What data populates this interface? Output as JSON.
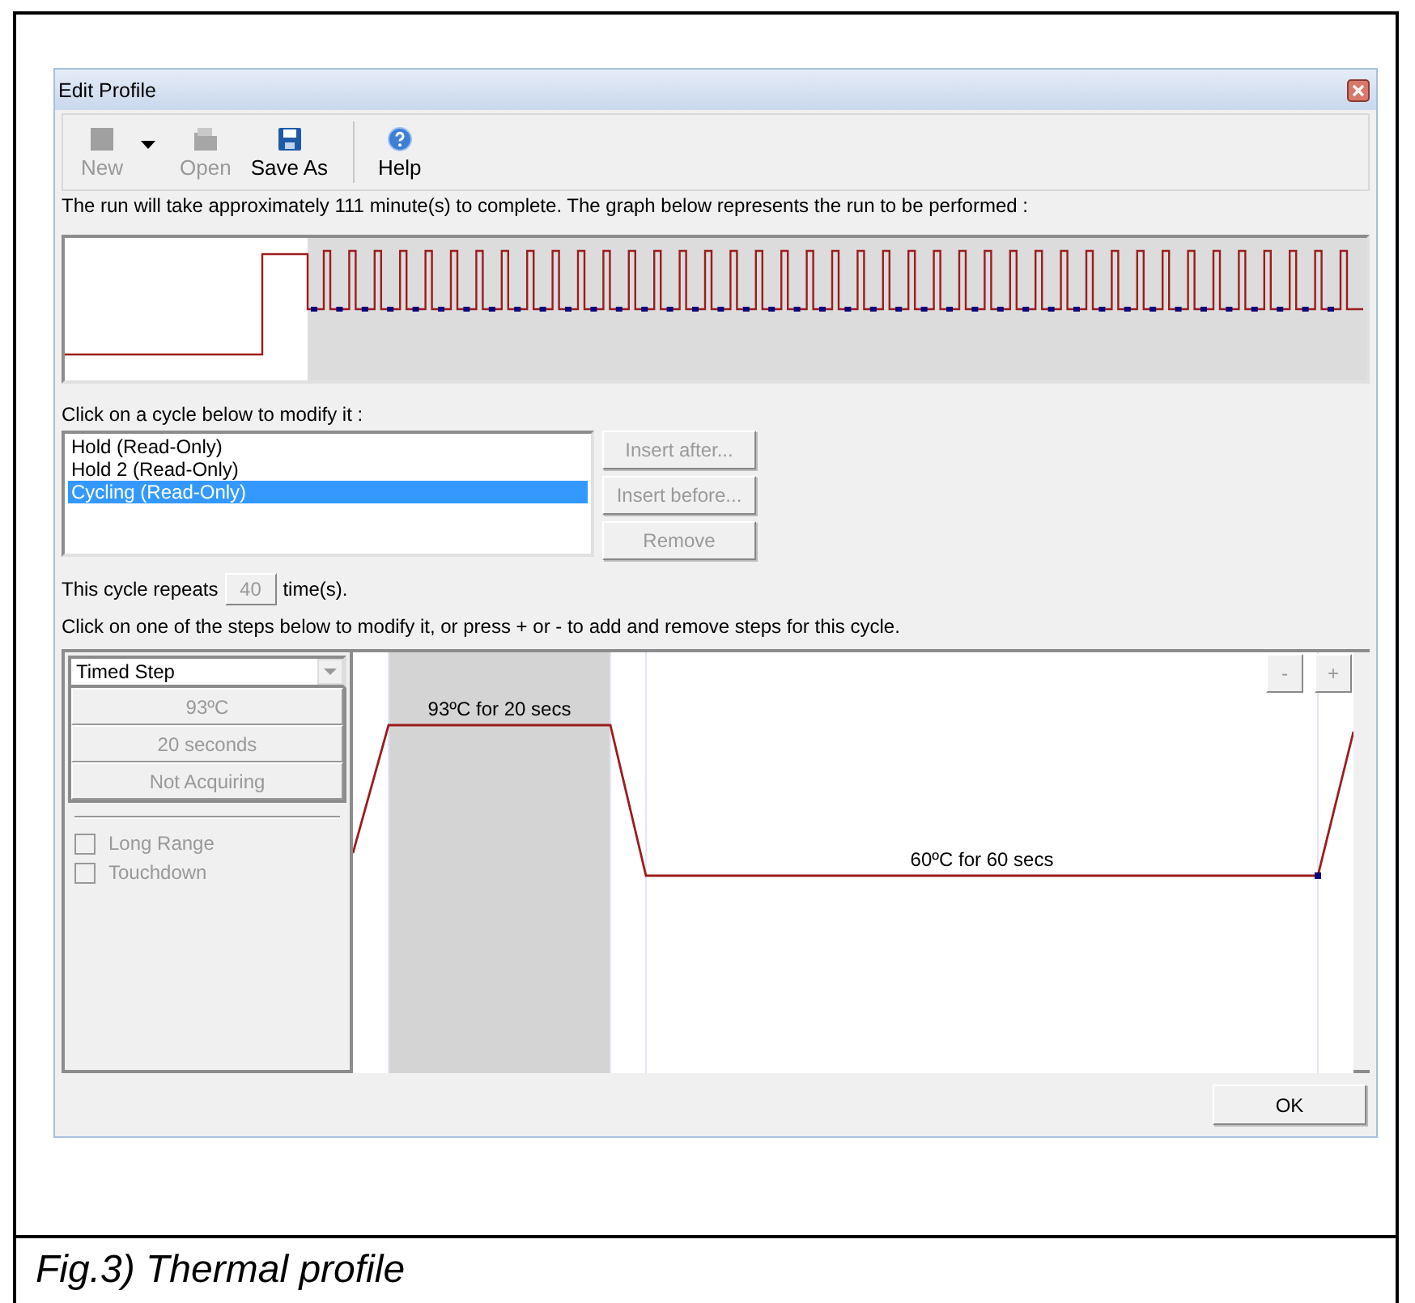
{
  "window": {
    "title": "Edit Profile"
  },
  "toolbar": [
    {
      "kind": "new",
      "label": "New",
      "disabled": true
    },
    {
      "kind": "dropdown"
    },
    {
      "kind": "open",
      "label": "Open",
      "disabled": true
    },
    {
      "kind": "save",
      "label": "Save As",
      "disabled": false
    },
    {
      "kind": "help",
      "label": "Help",
      "disabled": false
    }
  ],
  "summary": "The run will take approximately 111 minute(s) to complete. The graph below represents the run to be performed :",
  "cycles": {
    "label": "Click on a cycle below to modify it :",
    "items": [
      {
        "label": "Hold (Read-Only)",
        "selected": false
      },
      {
        "label": "Hold 2 (Read-Only)",
        "selected": false
      },
      {
        "label": "Cycling (Read-Only)",
        "selected": true
      }
    ]
  },
  "cycle_buttons": [
    {
      "label": "Insert after...",
      "disabled": true
    },
    {
      "label": "Insert before...",
      "disabled": true
    },
    {
      "label": "Remove",
      "disabled": true
    }
  ],
  "repeats": {
    "prefix": "This cycle repeats",
    "value": "40",
    "suffix": "time(s)."
  },
  "steps_hint": "Click on one of the steps below to modify it, or press + or - to add and remove steps for this cycle.",
  "step_editor": {
    "type": "Timed Step",
    "disabled": true,
    "fields": [
      "93ºC",
      "20 seconds",
      "Not Acquiring"
    ],
    "options": [
      {
        "label": "Long Range",
        "checked": false
      },
      {
        "label": "Touchdown",
        "checked": false
      }
    ]
  },
  "step_graph": {
    "steps": [
      {
        "label": "93ºC for 20 secs",
        "selected": true
      },
      {
        "label": "60ºC for 60 secs",
        "selected": false
      }
    ],
    "buttons": [
      "-",
      "+"
    ]
  },
  "buttons": [
    "OK"
  ],
  "figure": {
    "caption": "Fig.3) Thermal profile"
  }
}
